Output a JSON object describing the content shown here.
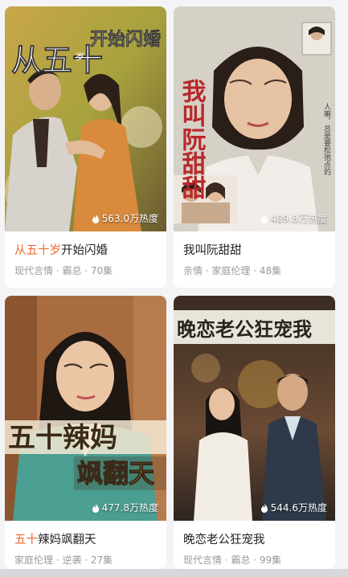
{
  "dramas": [
    {
      "poster_title_line1": "从五十",
      "poster_title_small": "岁",
      "poster_title_line2": "开始闪婚",
      "heat": "563.0万热度",
      "title_highlight": "从五十岁",
      "title_rest": "开始闪婚",
      "tags": "现代言情 · 霸总 · 70集"
    },
    {
      "poster_title": "我叫阮甜甜",
      "poster_side_text": "人嘛，总是要松弛点的",
      "heat": "489.8万热度",
      "title_highlight": "",
      "title_rest": "我叫阮甜甜",
      "tags": "亲情 · 家庭伦理 · 48集"
    },
    {
      "poster_title_line1": "五十辣妈",
      "poster_title_line2": "飒翻天",
      "heat": "477.8万热度",
      "title_highlight": "五十",
      "title_rest": "辣妈飒翻天",
      "tags": "家庭伦理 · 逆袭 · 27集"
    },
    {
      "poster_title": "晚恋老公狂宠我",
      "heat": "544.6万热度",
      "title_highlight": "",
      "title_rest": "晚恋老公狂宠我",
      "tags": "现代言情 · 霸总 · 99集"
    }
  ],
  "colors": {
    "highlight": "#f26a2e",
    "meta": "#9a9a9a"
  },
  "icons": {
    "heat": "flame-icon"
  }
}
